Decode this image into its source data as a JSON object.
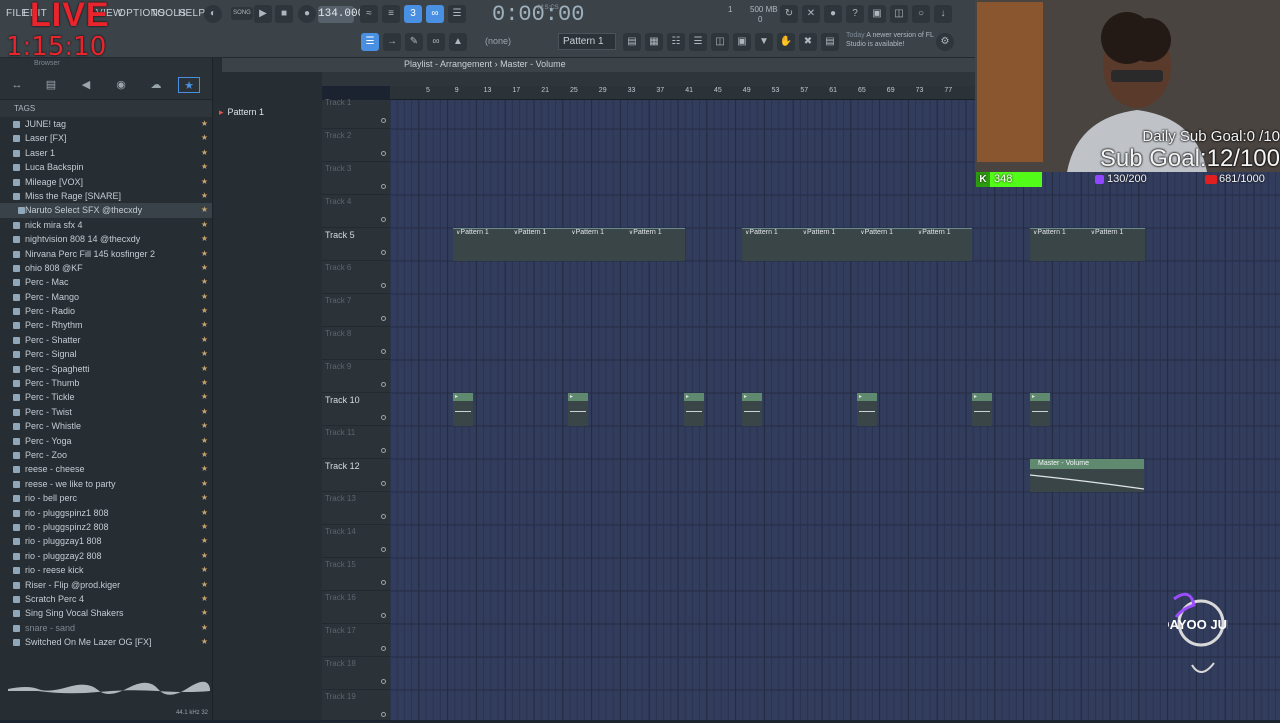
{
  "live": {
    "badge": "LIVE",
    "timer": "1:15:10"
  },
  "menu": {
    "file": "FILE",
    "edit": "EDIT",
    "view": "VIEW",
    "options": "OPTIONS",
    "tools": "TOOLS",
    "help": "HELP"
  },
  "transport": {
    "mode": "SONG",
    "tempo": "134.000",
    "time": "0:00:00",
    "time_unit": "M:S:CS",
    "cpu": "1",
    "memory_label": "500 MB",
    "memory_value": "0"
  },
  "pattern_select": "Pattern 1",
  "none_select": "(none)",
  "news": {
    "day": "Today",
    "text": "A newer version of FL Studio is available!"
  },
  "browser": {
    "label": "Browser",
    "tags_label": "TAGS",
    "items": [
      {
        "name": "JUNE! tag",
        "dim": false
      },
      {
        "name": "Laser [FX]",
        "dim": false
      },
      {
        "name": "Laser 1",
        "dim": false
      },
      {
        "name": "Luca Backspin",
        "dim": false
      },
      {
        "name": "Mileage [VOX]",
        "dim": false
      },
      {
        "name": "Miss the Rage [SNARE]",
        "dim": false
      },
      {
        "name": "Naruto Select SFX @thecxdy",
        "dim": false,
        "selected": true
      },
      {
        "name": "nick mira sfx 4",
        "dim": false
      },
      {
        "name": "nightvision 808 14 @thecxdy",
        "dim": false
      },
      {
        "name": "Nirvana Perc Fill 145 kosfinger 2",
        "dim": false
      },
      {
        "name": "ohio 808 @KF",
        "dim": false
      },
      {
        "name": "Perc - Mac",
        "dim": false
      },
      {
        "name": "Perc - Mango",
        "dim": false
      },
      {
        "name": "Perc - Radio",
        "dim": false
      },
      {
        "name": "Perc - Rhythm",
        "dim": false
      },
      {
        "name": "Perc - Shatter",
        "dim": false
      },
      {
        "name": "Perc - Signal",
        "dim": false
      },
      {
        "name": "Perc - Spaghetti",
        "dim": false
      },
      {
        "name": "Perc - Thumb",
        "dim": false
      },
      {
        "name": "Perc - Tickle",
        "dim": false
      },
      {
        "name": "Perc - Twist",
        "dim": false
      },
      {
        "name": "Perc - Whistle",
        "dim": false
      },
      {
        "name": "Perc - Yoga",
        "dim": false
      },
      {
        "name": "Perc - Zoo",
        "dim": false
      },
      {
        "name": "reese - cheese",
        "dim": false
      },
      {
        "name": "reese - we like to party",
        "dim": false
      },
      {
        "name": "rio - bell perc",
        "dim": false
      },
      {
        "name": "rio - pluggspinz1 808",
        "dim": false
      },
      {
        "name": "rio - pluggspinz2 808",
        "dim": false
      },
      {
        "name": "rio - pluggzay1 808",
        "dim": false
      },
      {
        "name": "rio - pluggzay2 808",
        "dim": false
      },
      {
        "name": "rio - reese kick",
        "dim": false
      },
      {
        "name": "Riser - Flip @prod.kiger",
        "dim": false
      },
      {
        "name": "Scratch Perc 4",
        "dim": false
      },
      {
        "name": "Sing Sing Vocal Shakers",
        "dim": false
      },
      {
        "name": "snare - sand",
        "dim": true
      },
      {
        "name": "Switched On Me Lazer OG [FX]",
        "dim": false
      }
    ],
    "sample_info": "44.1 kHz 32"
  },
  "pattern_panel": {
    "item": "Pattern 1"
  },
  "playlist": {
    "title": "Playlist - Arrangement",
    "breadcrumb": "Master - Volume",
    "ruler_ticks": [
      "5",
      "9",
      "13",
      "17",
      "21",
      "25",
      "29",
      "33",
      "37",
      "41",
      "45",
      "49",
      "53",
      "57",
      "61",
      "65",
      "69",
      "73",
      "77"
    ],
    "tracks": [
      "Track 1",
      "Track 2",
      "Track 3",
      "Track 4",
      "Track 5",
      "Track 6",
      "Track 7",
      "Track 8",
      "Track 9",
      "Track 10",
      "Track 11",
      "Track 12",
      "Track 13",
      "Track 14",
      "Track 15",
      "Track 16",
      "Track 17",
      "Track 18",
      "Track 19"
    ],
    "active_tracks": [
      "Track 5",
      "Track 10",
      "Track 12"
    ],
    "pattern_clip_label": "Pattern 1",
    "automation_clip_label": "Master - Volume"
  },
  "overlay": {
    "daily_sub_goal": "Daily Sub Goal:0  /10",
    "sub_goal": "Sub Goal:12/100",
    "kick_count": "348",
    "twitch_count": "130/200",
    "youtube_count": "681/1000",
    "logo_text": "@AYOO JUNE"
  }
}
